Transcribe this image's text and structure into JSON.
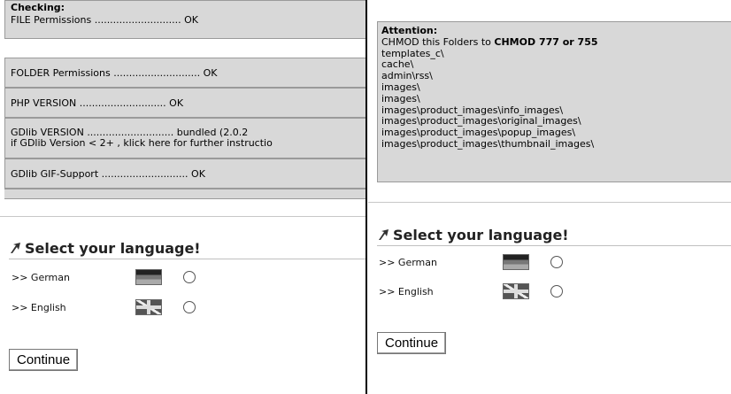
{
  "left": {
    "checks": {
      "heading": "Checking:",
      "file_permissions": "FILE Permissions ............................ OK",
      "folder_permissions": "FOLDER Permissions ............................ OK",
      "php_version": "PHP VERSION ............................ OK",
      "gdlib_version": "GDlib VERSION ............................ bundled (2.0.2",
      "gdlib_note": "if GDlib Version < 2+ , klick here for further instructio",
      "gdlib_gif": "GDlib GIF-Support ............................ OK"
    },
    "language": {
      "title": "Select your language!",
      "options": [
        {
          "label": ">> German",
          "flag": "german-flag"
        },
        {
          "label": ">> English",
          "flag": "uk-flag"
        }
      ],
      "continue_label": "Continue"
    }
  },
  "right": {
    "attention": {
      "heading": "Attention:",
      "intro": "CHMOD this Folders to ",
      "intro_bold": "CHMOD 777 or 755",
      "folders": [
        "templates_c\\",
        "cache\\",
        "admin\\rss\\",
        "images\\",
        "images\\",
        "images\\product_images\\info_images\\",
        "images\\product_images\\original_images\\",
        "images\\product_images\\popup_images\\",
        "images\\product_images\\thumbnail_images\\"
      ]
    },
    "language": {
      "title": "Select your language!",
      "options": [
        {
          "label": ">> German",
          "flag": "german-flag"
        },
        {
          "label": ">> English",
          "flag": "uk-flag"
        }
      ],
      "continue_label": "Continue"
    }
  }
}
